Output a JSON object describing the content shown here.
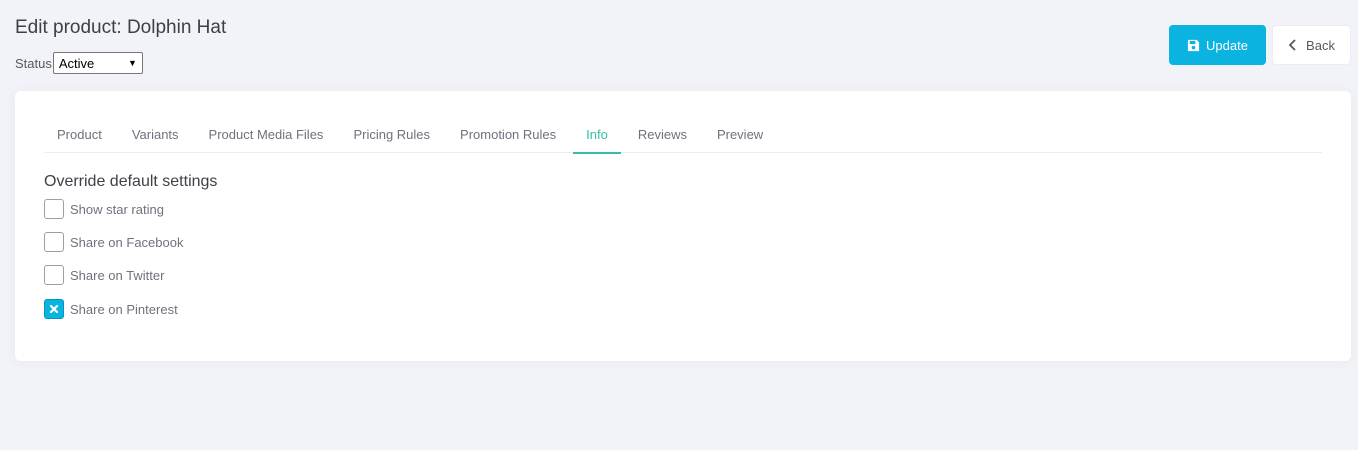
{
  "header": {
    "title": "Edit product: Dolphin Hat",
    "status_label": "Status",
    "status_value": "Active"
  },
  "actions": {
    "update_label": "Update",
    "back_label": "Back"
  },
  "tabs": [
    {
      "label": "Product",
      "active": false
    },
    {
      "label": "Variants",
      "active": false
    },
    {
      "label": "Product Media Files",
      "active": false
    },
    {
      "label": "Pricing Rules",
      "active": false
    },
    {
      "label": "Promotion Rules",
      "active": false
    },
    {
      "label": "Info",
      "active": true
    },
    {
      "label": "Reviews",
      "active": false
    },
    {
      "label": "Preview",
      "active": false
    }
  ],
  "section": {
    "title": "Override default settings",
    "options": [
      {
        "label": "Show star rating",
        "checked": false
      },
      {
        "label": "Share on Facebook",
        "checked": false
      },
      {
        "label": "Share on Twitter",
        "checked": false
      },
      {
        "label": "Share on Pinterest",
        "checked": true
      }
    ]
  },
  "colors": {
    "primary": "#0bb4e0",
    "active_tab": "#34bfa3",
    "background": "#f2f3f8"
  }
}
